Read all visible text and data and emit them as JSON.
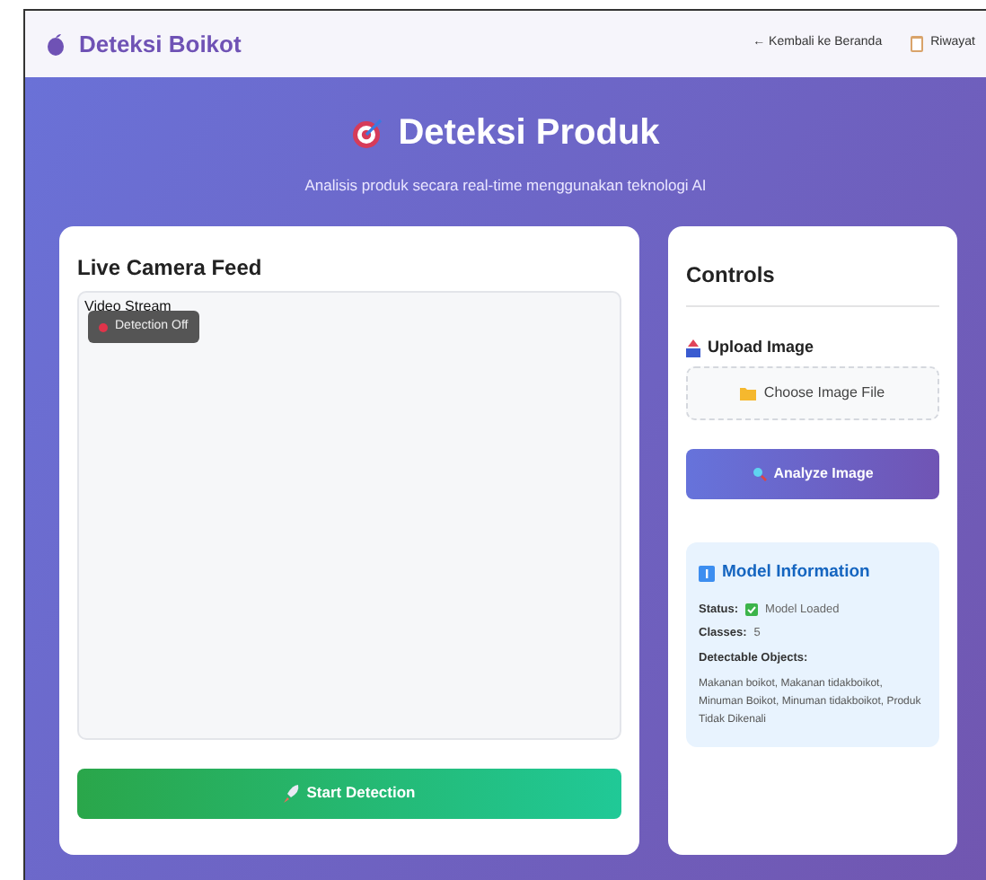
{
  "navbar": {
    "brand": "Deteksi Boikot",
    "links": [
      {
        "label": "← Kembali ke Beranda",
        "kind": "text"
      },
      {
        "label": "Riwayat",
        "kind": "clipboard"
      }
    ]
  },
  "hero": {
    "title": "Deteksi Produk",
    "subtitle": "Analisis produk secara real-time menggunakan teknologi AI"
  },
  "camera": {
    "title": "Live Camera Feed",
    "video_label": "Video Stream",
    "detection": {
      "label": "Detection Off",
      "on": false
    },
    "button": "Start Detection"
  },
  "controls": {
    "title": "Controls",
    "upload_label": "Upload Image",
    "file_button": "Choose Image File",
    "analyze_button": "Analyze Image",
    "model": {
      "title": "Model Information",
      "rows": [
        {
          "label": "Status:",
          "value": "Model Loaded",
          "checked": true
        },
        {
          "label": "Classes:",
          "value": "5"
        },
        {
          "label": "Detectable Objects:"
        }
      ],
      "objects": "Makanan boikot, Makanan tidakboikot, Minuman Boikot, Minuman tidakboikot, Produk Tidak Dikenali"
    }
  }
}
